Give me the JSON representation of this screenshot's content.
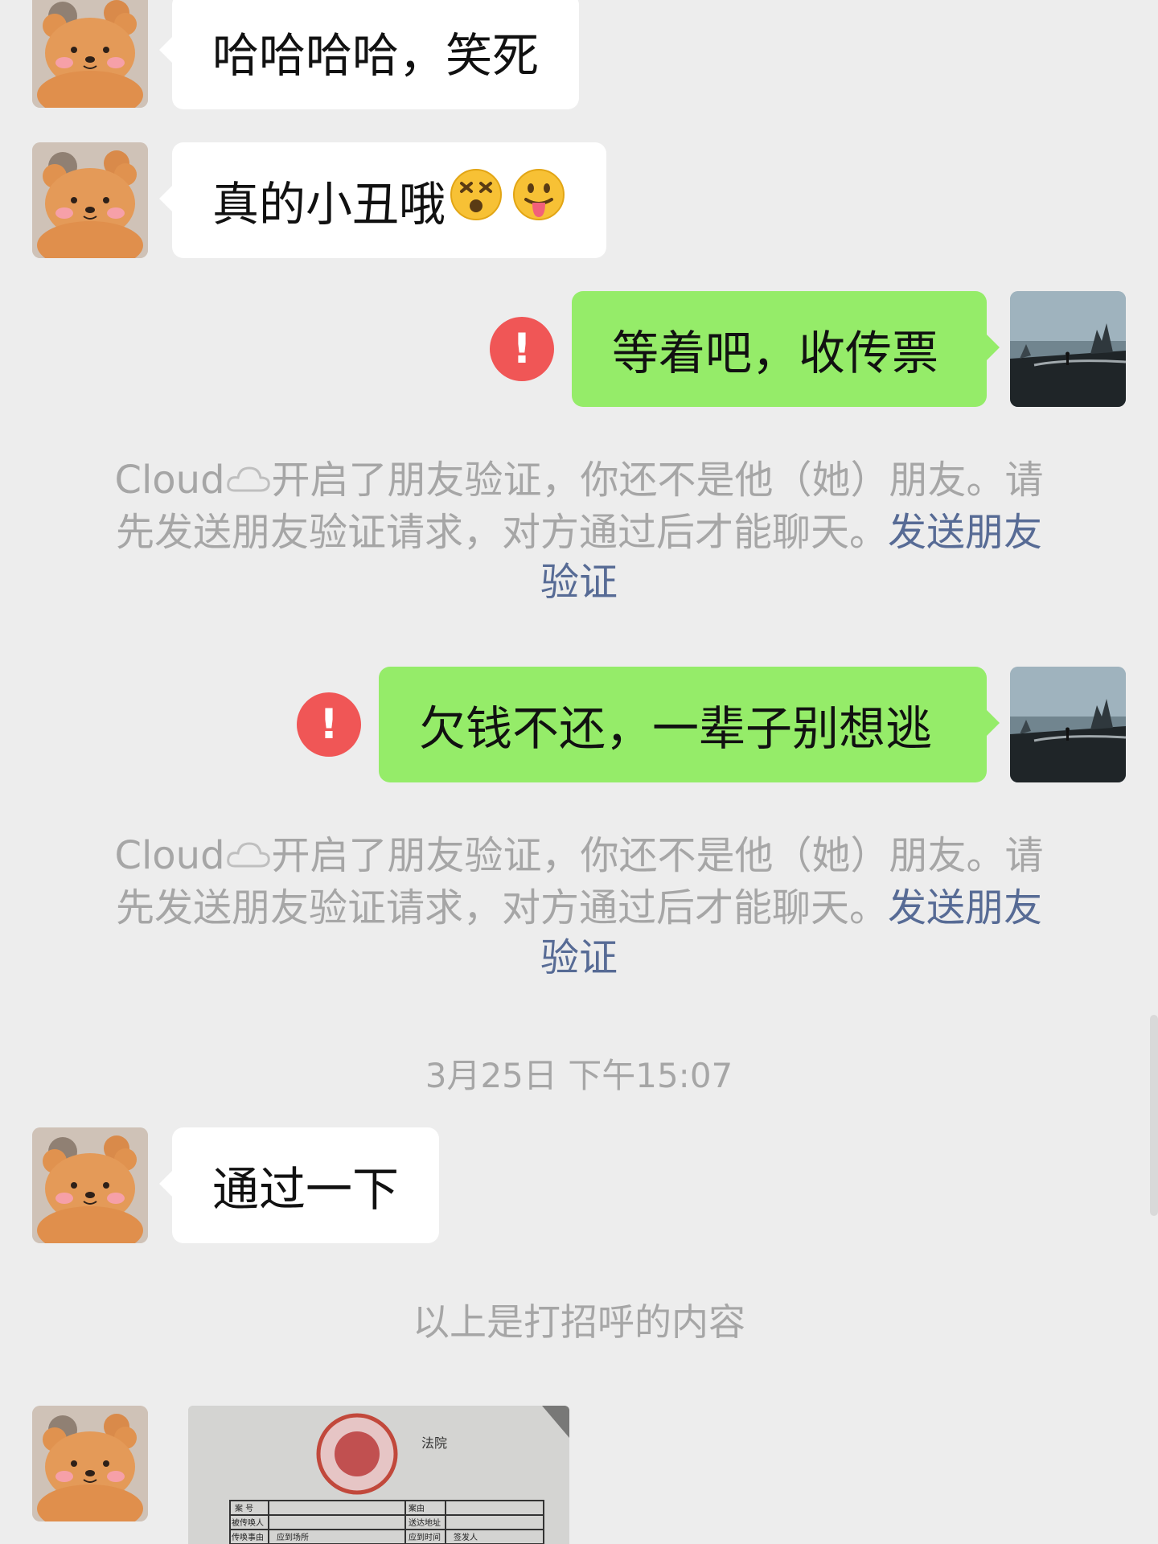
{
  "messages": {
    "m1": {
      "text": "哈哈哈哈，笑死"
    },
    "m2": {
      "text": "真的小丑哦",
      "emojis": [
        "dizzy-face-emoji",
        "tongue-out-emoji"
      ]
    },
    "m3": {
      "text": "等着吧，收传票"
    },
    "m4": {
      "text": "欠钱不还，一辈子别想逃"
    },
    "m5": {
      "text": "通过一下"
    }
  },
  "system_notice": {
    "name": "Cloud",
    "line1": "开启了朋友验证，你还不是他（她）朋友。请",
    "line2": "先发送朋友验证请求，对方通过后才能聊天。",
    "link_a": "发送朋友",
    "link_b": "验证"
  },
  "timestamp": "3月25日 下午15:07",
  "greeting_label": "以上是打招呼的内容",
  "colors": {
    "background": "#ededed",
    "incoming_bubble": "#ffffff",
    "outgoing_bubble": "#95ec69",
    "error": "#f05656",
    "link": "#576b95",
    "system_text": "#a6a6a6"
  },
  "icons": {
    "error": "exclamation-circle-icon",
    "cloud": "cloud-icon"
  },
  "error_glyph": "!",
  "document_image": {
    "stamp_text": "法院",
    "cells": [
      "案 号",
      "案由",
      "被传唤人",
      "送达地址",
      "传唤事由",
      "应到场所",
      "应到时间",
      "签发人"
    ]
  }
}
